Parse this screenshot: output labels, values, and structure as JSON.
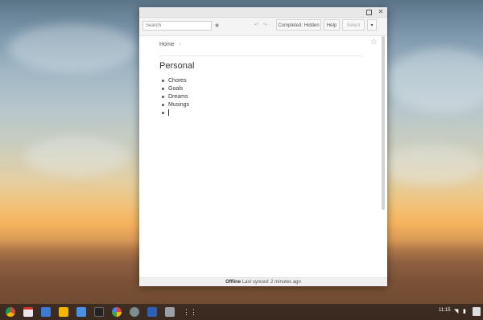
{
  "window": {
    "search": {
      "placeholder": "Search"
    },
    "toolbar": {
      "completed_label": "Completed: Hidden",
      "help_label": "Help",
      "select_label": "Select",
      "more_label": "▾"
    },
    "content": {
      "breadcrumb": [
        "Home"
      ],
      "title": "Personal",
      "items": [
        "Chores",
        "Goals",
        "Dreams",
        "Musings"
      ]
    },
    "status": {
      "state": "Offline",
      "detail": "Last synced: 2 minutes ago"
    }
  },
  "shelf": {
    "apps": [
      "chrome-icon",
      "calendar-icon",
      "files-icon",
      "keep-icon",
      "docs-icon",
      "terminal-icon",
      "pinwheel-icon",
      "camera-icon",
      "screen-icon",
      "photos-icon",
      "apps-launcher-icon"
    ],
    "time": "11:15"
  }
}
